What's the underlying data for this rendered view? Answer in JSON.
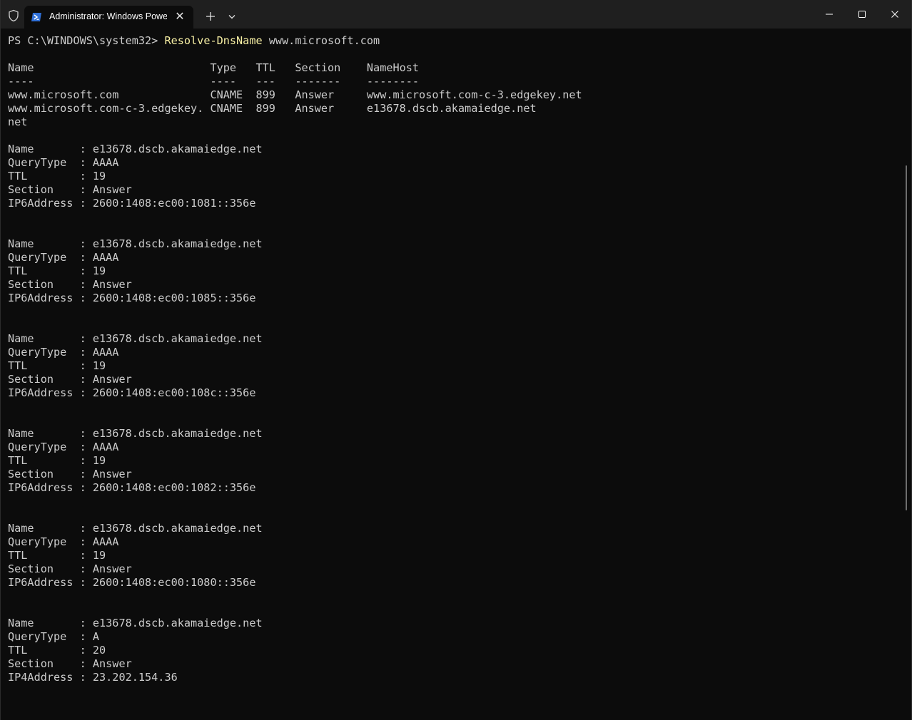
{
  "window": {
    "tab_title": "Administrator: Windows PowerShell",
    "close_tab_glyph": "✕"
  },
  "terminal": {
    "prompt": "PS C:\\WINDOWS\\system32> ",
    "command": "Resolve-DnsName",
    "argument": " www.microsoft.com",
    "lines": [
      "",
      "Name                           Type   TTL   Section    NameHost",
      "----                           ----   ---   -------    --------",
      "www.microsoft.com              CNAME  899   Answer     www.microsoft.com-c-3.edgekey.net",
      "www.microsoft.com-c-3.edgekey. CNAME  899   Answer     e13678.dscb.akamaiedge.net",
      "net",
      "",
      "Name       : e13678.dscb.akamaiedge.net",
      "QueryType  : AAAA",
      "TTL        : 19",
      "Section    : Answer",
      "IP6Address : 2600:1408:ec00:1081::356e",
      "",
      "",
      "Name       : e13678.dscb.akamaiedge.net",
      "QueryType  : AAAA",
      "TTL        : 19",
      "Section    : Answer",
      "IP6Address : 2600:1408:ec00:1085::356e",
      "",
      "",
      "Name       : e13678.dscb.akamaiedge.net",
      "QueryType  : AAAA",
      "TTL        : 19",
      "Section    : Answer",
      "IP6Address : 2600:1408:ec00:108c::356e",
      "",
      "",
      "Name       : e13678.dscb.akamaiedge.net",
      "QueryType  : AAAA",
      "TTL        : 19",
      "Section    : Answer",
      "IP6Address : 2600:1408:ec00:1082::356e",
      "",
      "",
      "Name       : e13678.dscb.akamaiedge.net",
      "QueryType  : AAAA",
      "TTL        : 19",
      "Section    : Answer",
      "IP6Address : 2600:1408:ec00:1080::356e",
      "",
      "",
      "Name       : e13678.dscb.akamaiedge.net",
      "QueryType  : A",
      "TTL        : 20",
      "Section    : Answer",
      "IP4Address : 23.202.154.36"
    ]
  },
  "colors": {
    "background": "#0c0c0c",
    "text": "#cccccc",
    "command_highlight": "#f9f1a5",
    "titlebar": "#1f1f1f"
  },
  "icons": {
    "shield": "shield-icon",
    "powershell": "powershell-icon",
    "new_tab": "plus-icon",
    "dropdown": "chevron-down-icon",
    "minimize": "minimize-icon",
    "maximize": "maximize-icon",
    "close": "close-icon"
  }
}
